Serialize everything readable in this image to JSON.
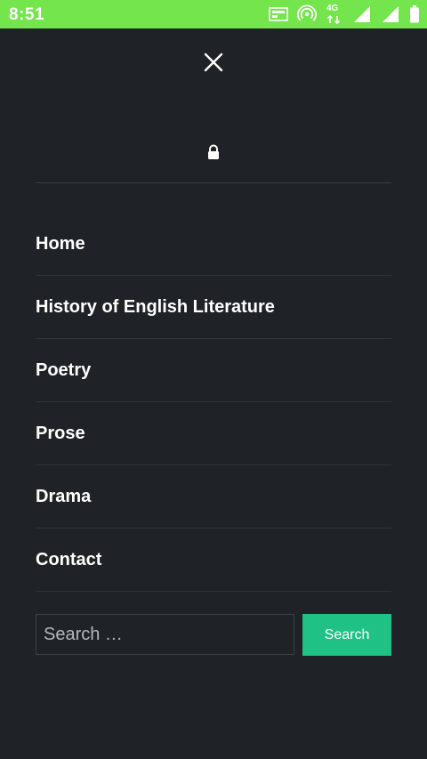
{
  "status_bar": {
    "time": "8:51",
    "network": "4G",
    "background_color": "#74e54c",
    "icons": [
      "volte-icon",
      "hotspot-icon",
      "4g-data-icon",
      "signal-icon",
      "signal-icon",
      "battery-icon"
    ]
  },
  "menu": {
    "close_icon": "close-icon",
    "lock_icon": "lock-icon",
    "items": [
      {
        "label": "Home"
      },
      {
        "label": "History of English Literature"
      },
      {
        "label": "Poetry"
      },
      {
        "label": "Prose"
      },
      {
        "label": "Drama"
      },
      {
        "label": "Contact"
      }
    ]
  },
  "search": {
    "placeholder": "Search …",
    "button_label": "Search",
    "button_color": "#1fc184"
  },
  "colors": {
    "background": "#1f2226",
    "text": "#ffffff",
    "divider": "#30353a"
  }
}
